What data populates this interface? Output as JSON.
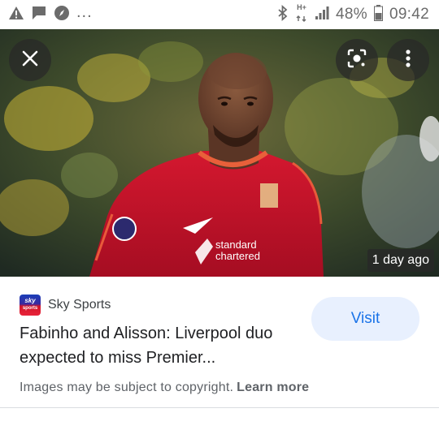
{
  "status_bar": {
    "left_icons": [
      "warning-icon",
      "chat-icon",
      "compass-icon"
    ],
    "overflow": "...",
    "network": "H+",
    "battery_percent": "48%",
    "time": "09:42"
  },
  "image_viewer": {
    "close_icon": "close-icon",
    "lens_icon": "lens-icon",
    "more_icon": "more-vert-icon",
    "timestamp": "1 day ago"
  },
  "result": {
    "source_logo_line1": "sky",
    "source_logo_line2": "sports",
    "source_name": "Sky Sports",
    "title": "Fabinho and Alisson: Liverpool duo expected to miss Premier...",
    "visit_label": "Visit"
  },
  "footer": {
    "copyright_text": "Images may be subject to copyright.",
    "learn_more_label": "Learn more"
  },
  "colors": {
    "accent": "#1a73e8",
    "visit_bg": "#e8f0fe",
    "jersey_red": "#c8102e"
  }
}
